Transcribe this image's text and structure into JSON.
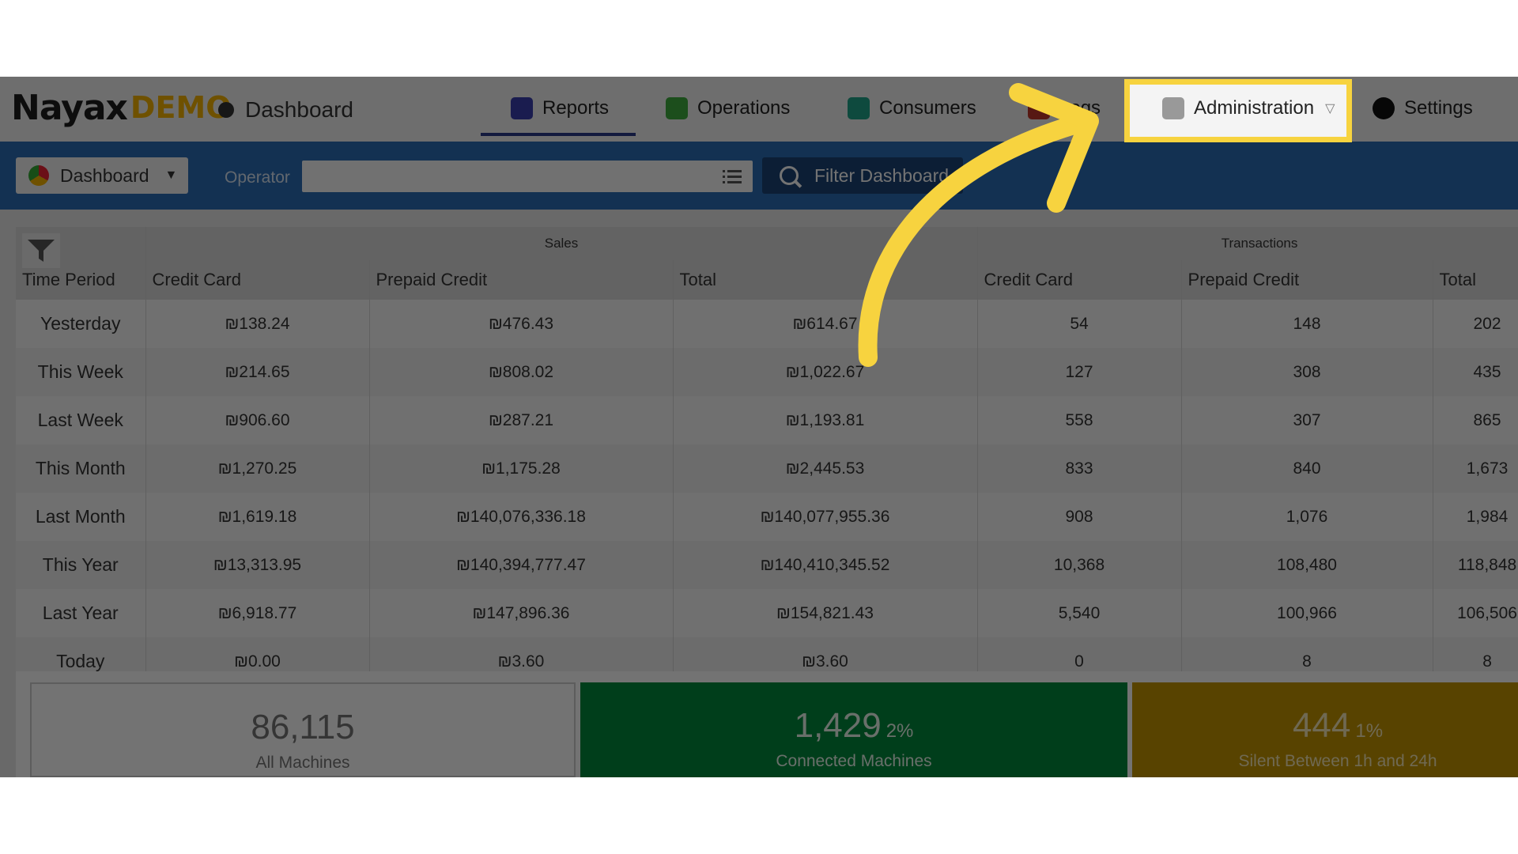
{
  "brand": {
    "logo_main": "Nayax",
    "logo_suffix": "DEMO"
  },
  "breadcrumb": {
    "label": "Dashboard"
  },
  "nav": {
    "reports": "Reports",
    "operations": "Operations",
    "consumers": "Consumers",
    "logs": "Logs",
    "administration": "Administration",
    "settings": "Settings"
  },
  "filterbar": {
    "dashboard_select": "Dashboard",
    "operator_label": "Operator",
    "operator_value": "",
    "filter_button": "Filter Dashboard"
  },
  "table": {
    "groups": {
      "sales": "Sales",
      "transactions": "Transactions"
    },
    "columns": [
      "Time Period",
      "Credit Card",
      "Prepaid Credit",
      "Total",
      "Credit Card",
      "Prepaid Credit",
      "Total"
    ],
    "rows": [
      [
        "Yesterday",
        "₪138.24",
        "₪476.43",
        "₪614.67",
        "54",
        "148",
        "202"
      ],
      [
        "This Week",
        "₪214.65",
        "₪808.02",
        "₪1,022.67",
        "127",
        "308",
        "435"
      ],
      [
        "Last Week",
        "₪906.60",
        "₪287.21",
        "₪1,193.81",
        "558",
        "307",
        "865"
      ],
      [
        "This Month",
        "₪1,270.25",
        "₪1,175.28",
        "₪2,445.53",
        "833",
        "840",
        "1,673"
      ],
      [
        "Last Month",
        "₪1,619.18",
        "₪140,076,336.18",
        "₪140,077,955.36",
        "908",
        "1,076",
        "1,984"
      ],
      [
        "This Year",
        "₪13,313.95",
        "₪140,394,777.47",
        "₪140,410,345.52",
        "10,368",
        "108,480",
        "118,848"
      ],
      [
        "Last Year",
        "₪6,918.77",
        "₪147,896.36",
        "₪154,821.43",
        "5,540",
        "100,966",
        "106,506"
      ],
      [
        "Today",
        "₪0.00",
        "₪3.60",
        "₪3.60",
        "0",
        "8",
        "8"
      ]
    ]
  },
  "cards": {
    "all": {
      "value": "86,115",
      "label": "All Machines"
    },
    "connected": {
      "value": "1,429",
      "pct": "2%",
      "label": "Connected Machines"
    },
    "silent": {
      "value": "444",
      "pct": "1%",
      "label": "Silent Between 1h and 24h"
    }
  },
  "colors": {
    "highlight": "#f7d33f",
    "header_blue": "#2a6db5",
    "connected_green": "#008a3c",
    "silent_gold": "#c49600"
  }
}
